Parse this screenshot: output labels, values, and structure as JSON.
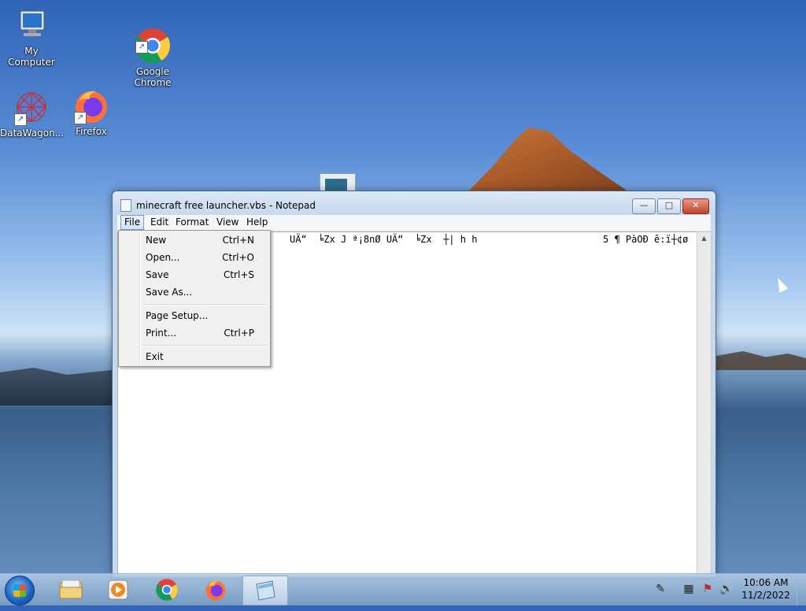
{
  "desktop": {
    "icons": [
      {
        "label": "My Computer"
      },
      {
        "label": "Google\nChrome"
      },
      {
        "label": "DataWagon..."
      },
      {
        "label": "Firefox"
      }
    ]
  },
  "window": {
    "title": "minecraft free launcher.vbs - Notepad",
    "controls": {
      "minimize": "—",
      "maximize": "□",
      "close": "✕"
    }
  },
  "menubar": {
    "items": [
      "File",
      "Edit",
      "Format",
      "View",
      "Help"
    ]
  },
  "file_menu": {
    "items": [
      {
        "label": "New",
        "shortcut": "Ctrl+N"
      },
      {
        "label": "Open...",
        "shortcut": "Ctrl+O"
      },
      {
        "label": "Save",
        "shortcut": "Ctrl+S"
      },
      {
        "label": "Save As...",
        "shortcut": ""
      },
      {
        "label": "Page Setup...",
        "shortcut": ""
      },
      {
        "label": "Print...",
        "shortcut": "Ctrl+P"
      },
      {
        "label": "Exit",
        "shortcut": ""
      }
    ]
  },
  "editor": {
    "text_left": "UÄ“  ╘Zx J ª¡8nØ UÄ“  ╘Zx  ┼| h h",
    "text_right": "5 ¶ PàOÐ ê:ï┼¢ø"
  },
  "taskbar": {
    "icons": [
      "windows-explorer-icon",
      "media-player-icon",
      "chrome-icon",
      "firefox-icon",
      "notepad-icon"
    ],
    "clock_time": "10:06 AM",
    "clock_date": "11/2/2022"
  }
}
